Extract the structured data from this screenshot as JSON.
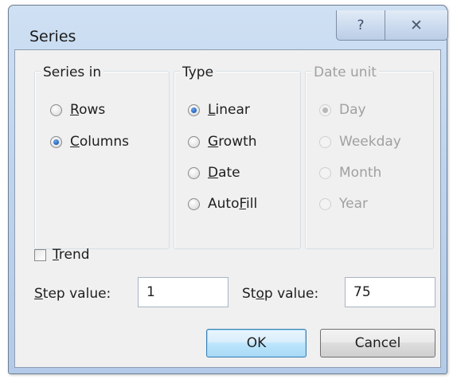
{
  "window": {
    "title": "Series",
    "help_glyph": "?",
    "close_glyph": "✕"
  },
  "series_in": {
    "legend": "Series in",
    "options": [
      {
        "label_pre": "",
        "label_key": "R",
        "label_post": "ows",
        "selected": false
      },
      {
        "label_pre": "",
        "label_key": "C",
        "label_post": "olumns",
        "selected": true
      }
    ]
  },
  "type": {
    "legend": "Type",
    "options": [
      {
        "label_pre": "",
        "label_key": "L",
        "label_post": "inear",
        "selected": true
      },
      {
        "label_pre": "",
        "label_key": "G",
        "label_post": "rowth",
        "selected": false
      },
      {
        "label_pre": "",
        "label_key": "D",
        "label_post": "ate",
        "selected": false
      },
      {
        "label_pre": "Auto",
        "label_key": "F",
        "label_post": "ill",
        "selected": false
      }
    ]
  },
  "date_unit": {
    "legend": "Date unit",
    "enabled": false,
    "options": [
      {
        "label": "Day",
        "selected": true
      },
      {
        "label": "Weekday",
        "selected": false
      },
      {
        "label": "Month",
        "selected": false
      },
      {
        "label": "Year",
        "selected": false
      }
    ]
  },
  "trend": {
    "label_key": "T",
    "label_post": "rend",
    "checked": false
  },
  "step_value": {
    "label_key": "S",
    "label_post": "tep value:",
    "value": "1"
  },
  "stop_value": {
    "label_pre": "St",
    "label_key": "o",
    "label_post": "p value:",
    "value": "75"
  },
  "buttons": {
    "ok": "OK",
    "cancel": "Cancel"
  }
}
